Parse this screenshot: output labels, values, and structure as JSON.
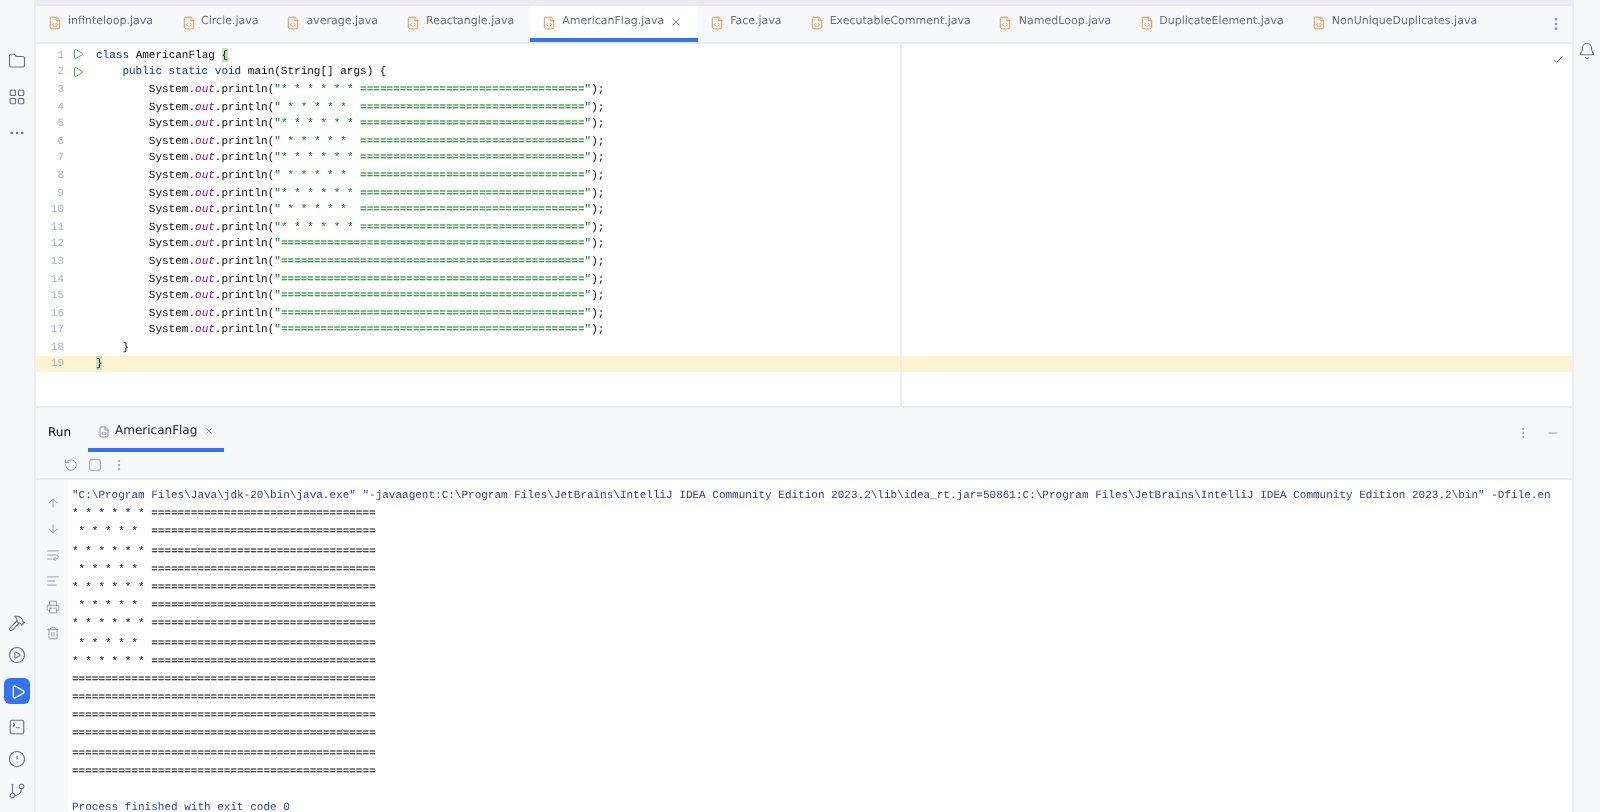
{
  "tabs": [
    {
      "label": "infinteloop.java",
      "selected": false,
      "closable": false
    },
    {
      "label": "Circle.java",
      "selected": false,
      "closable": false
    },
    {
      "label": "average.java",
      "selected": false,
      "closable": false
    },
    {
      "label": "Reactangle.java",
      "selected": false,
      "closable": false
    },
    {
      "label": "AmericanFlag.java",
      "selected": true,
      "closable": true
    },
    {
      "label": "Face.java",
      "selected": false,
      "closable": false
    },
    {
      "label": "ExecutableComment.java",
      "selected": false,
      "closable": false
    },
    {
      "label": "NamedLoop.java",
      "selected": false,
      "closable": false
    },
    {
      "label": "DuplicateElement.java",
      "selected": false,
      "closable": false
    },
    {
      "label": "NonUniqueDuplicates.java",
      "selected": false,
      "closable": false
    }
  ],
  "code_lines": [
    {
      "number": "1",
      "run_marker": true,
      "current": false,
      "tokens": [
        {
          "kind": "keyword",
          "text": "class "
        },
        {
          "kind": "plain",
          "text": "AmericanFlag "
        },
        {
          "kind": "brace",
          "text": "{"
        }
      ]
    },
    {
      "number": "2",
      "run_marker": true,
      "current": false,
      "tokens": [
        {
          "kind": "keyword",
          "text": "    public static void "
        },
        {
          "kind": "plain",
          "text": "main(String[] args) {"
        }
      ]
    },
    {
      "number": "3",
      "run_marker": false,
      "current": false,
      "tokens": [
        {
          "kind": "plain",
          "text": "        System."
        },
        {
          "kind": "field",
          "text": "out"
        },
        {
          "kind": "plain",
          "text": ".println("
        },
        {
          "kind": "string",
          "text": "\"* * * * * * ==================================\""
        },
        {
          "kind": "plain",
          "text": ");"
        }
      ]
    },
    {
      "number": "4",
      "run_marker": false,
      "current": false,
      "tokens": [
        {
          "kind": "plain",
          "text": "        System."
        },
        {
          "kind": "field",
          "text": "out"
        },
        {
          "kind": "plain",
          "text": ".println("
        },
        {
          "kind": "string",
          "text": "\" * * * * *  ==================================\""
        },
        {
          "kind": "plain",
          "text": ");"
        }
      ]
    },
    {
      "number": "5",
      "run_marker": false,
      "current": false,
      "tokens": [
        {
          "kind": "plain",
          "text": "        System."
        },
        {
          "kind": "field",
          "text": "out"
        },
        {
          "kind": "plain",
          "text": ".println("
        },
        {
          "kind": "string",
          "text": "\"* * * * * * ==================================\""
        },
        {
          "kind": "plain",
          "text": ");"
        }
      ]
    },
    {
      "number": "6",
      "run_marker": false,
      "current": false,
      "tokens": [
        {
          "kind": "plain",
          "text": "        System."
        },
        {
          "kind": "field",
          "text": "out"
        },
        {
          "kind": "plain",
          "text": ".println("
        },
        {
          "kind": "string",
          "text": "\" * * * * *  ==================================\""
        },
        {
          "kind": "plain",
          "text": ");"
        }
      ]
    },
    {
      "number": "7",
      "run_marker": false,
      "current": false,
      "tokens": [
        {
          "kind": "plain",
          "text": "        System."
        },
        {
          "kind": "field",
          "text": "out"
        },
        {
          "kind": "plain",
          "text": ".println("
        },
        {
          "kind": "string",
          "text": "\"* * * * * * ==================================\""
        },
        {
          "kind": "plain",
          "text": ");"
        }
      ]
    },
    {
      "number": "8",
      "run_marker": false,
      "current": false,
      "tokens": [
        {
          "kind": "plain",
          "text": "        System."
        },
        {
          "kind": "field",
          "text": "out"
        },
        {
          "kind": "plain",
          "text": ".println("
        },
        {
          "kind": "string",
          "text": "\" * * * * *  ==================================\""
        },
        {
          "kind": "plain",
          "text": ");"
        }
      ]
    },
    {
      "number": "9",
      "run_marker": false,
      "current": false,
      "tokens": [
        {
          "kind": "plain",
          "text": "        System."
        },
        {
          "kind": "field",
          "text": "out"
        },
        {
          "kind": "plain",
          "text": ".println("
        },
        {
          "kind": "string",
          "text": "\"* * * * * * ==================================\""
        },
        {
          "kind": "plain",
          "text": ");"
        }
      ]
    },
    {
      "number": "10",
      "run_marker": false,
      "current": false,
      "tokens": [
        {
          "kind": "plain",
          "text": "        System."
        },
        {
          "kind": "field",
          "text": "out"
        },
        {
          "kind": "plain",
          "text": ".println("
        },
        {
          "kind": "string",
          "text": "\" * * * * *  ==================================\""
        },
        {
          "kind": "plain",
          "text": ");"
        }
      ]
    },
    {
      "number": "11",
      "run_marker": false,
      "current": false,
      "tokens": [
        {
          "kind": "plain",
          "text": "        System."
        },
        {
          "kind": "field",
          "text": "out"
        },
        {
          "kind": "plain",
          "text": ".println("
        },
        {
          "kind": "string",
          "text": "\"* * * * * * ==================================\""
        },
        {
          "kind": "plain",
          "text": ");"
        }
      ]
    },
    {
      "number": "12",
      "run_marker": false,
      "current": false,
      "tokens": [
        {
          "kind": "plain",
          "text": "        System."
        },
        {
          "kind": "field",
          "text": "out"
        },
        {
          "kind": "plain",
          "text": ".println("
        },
        {
          "kind": "string",
          "text": "\"==============================================\""
        },
        {
          "kind": "plain",
          "text": ");"
        }
      ]
    },
    {
      "number": "13",
      "run_marker": false,
      "current": false,
      "tokens": [
        {
          "kind": "plain",
          "text": "        System."
        },
        {
          "kind": "field",
          "text": "out"
        },
        {
          "kind": "plain",
          "text": ".println("
        },
        {
          "kind": "string",
          "text": "\"==============================================\""
        },
        {
          "kind": "plain",
          "text": ");"
        }
      ]
    },
    {
      "number": "14",
      "run_marker": false,
      "current": false,
      "tokens": [
        {
          "kind": "plain",
          "text": "        System."
        },
        {
          "kind": "field",
          "text": "out"
        },
        {
          "kind": "plain",
          "text": ".println("
        },
        {
          "kind": "string",
          "text": "\"==============================================\""
        },
        {
          "kind": "plain",
          "text": ");"
        }
      ]
    },
    {
      "number": "15",
      "run_marker": false,
      "current": false,
      "tokens": [
        {
          "kind": "plain",
          "text": "        System."
        },
        {
          "kind": "field",
          "text": "out"
        },
        {
          "kind": "plain",
          "text": ".println("
        },
        {
          "kind": "string",
          "text": "\"==============================================\""
        },
        {
          "kind": "plain",
          "text": ");"
        }
      ]
    },
    {
      "number": "16",
      "run_marker": false,
      "current": false,
      "tokens": [
        {
          "kind": "plain",
          "text": "        System."
        },
        {
          "kind": "field",
          "text": "out"
        },
        {
          "kind": "plain",
          "text": ".println("
        },
        {
          "kind": "string",
          "text": "\"==============================================\""
        },
        {
          "kind": "plain",
          "text": ");"
        }
      ]
    },
    {
      "number": "17",
      "run_marker": false,
      "current": false,
      "tokens": [
        {
          "kind": "plain",
          "text": "        System."
        },
        {
          "kind": "field",
          "text": "out"
        },
        {
          "kind": "plain",
          "text": ".println("
        },
        {
          "kind": "string",
          "text": "\"==============================================\""
        },
        {
          "kind": "plain",
          "text": ");"
        }
      ]
    },
    {
      "number": "18",
      "run_marker": false,
      "current": false,
      "tokens": [
        {
          "kind": "plain",
          "text": "    }"
        }
      ]
    },
    {
      "number": "19",
      "run_marker": false,
      "current": true,
      "tokens": [
        {
          "kind": "brace",
          "text": "}"
        }
      ]
    }
  ],
  "run_panel": {
    "title": "Run",
    "tabs": [
      {
        "label": "AmericanFlag",
        "selected": true
      }
    ]
  },
  "console_lines": [
    {
      "kind": "command",
      "text": "\"C:\\Program Files\\Java\\jdk-20\\bin\\java.exe\" \"-javaagent:C:\\Program Files\\JetBrains\\IntelliJ IDEA Community Edition 2023.2\\lib\\idea_rt.jar=50861:C:\\Program Files\\JetBrains\\IntelliJ IDEA Community Edition 2023.2\\bin\" -Dfile.en"
    },
    {
      "kind": "output",
      "text": "* * * * * * =================================="
    },
    {
      "kind": "output",
      "text": " * * * * *  =================================="
    },
    {
      "kind": "output",
      "text": "* * * * * * =================================="
    },
    {
      "kind": "output",
      "text": " * * * * *  =================================="
    },
    {
      "kind": "output",
      "text": "* * * * * * =================================="
    },
    {
      "kind": "output",
      "text": " * * * * *  =================================="
    },
    {
      "kind": "output",
      "text": "* * * * * * =================================="
    },
    {
      "kind": "output",
      "text": " * * * * *  =================================="
    },
    {
      "kind": "output",
      "text": "* * * * * * =================================="
    },
    {
      "kind": "output",
      "text": "=============================================="
    },
    {
      "kind": "output",
      "text": "=============================================="
    },
    {
      "kind": "output",
      "text": "=============================================="
    },
    {
      "kind": "output",
      "text": "=============================================="
    },
    {
      "kind": "output",
      "text": "=============================================="
    },
    {
      "kind": "output",
      "text": "=============================================="
    },
    {
      "kind": "exit",
      "text": "Process finished with exit code 0"
    }
  ]
}
